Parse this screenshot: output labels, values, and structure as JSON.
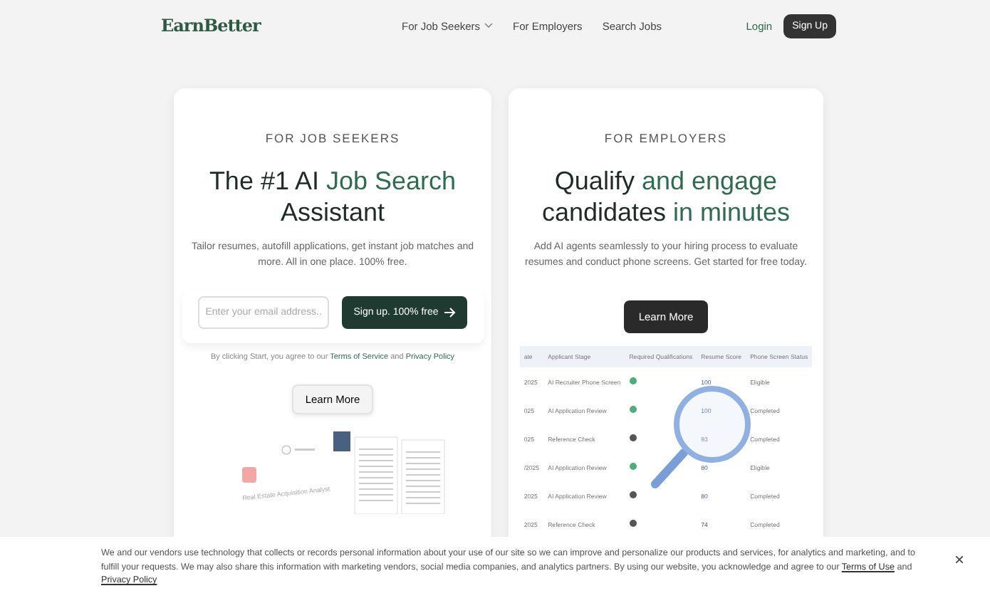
{
  "nav": {
    "logo": "EarnBetter",
    "links": [
      {
        "label": "For Job Seekers",
        "dropdown": true
      },
      {
        "label": "For Employers",
        "dropdown": false
      },
      {
        "label": "Search Jobs",
        "dropdown": false
      }
    ],
    "login": "Login",
    "signup": "Sign Up"
  },
  "seekers": {
    "eyebrow": "FOR JOB SEEKERS",
    "title": [
      {
        "text": "The #1 AI ",
        "accent": false
      },
      {
        "text": "Job Search",
        "accent": true
      },
      {
        "text": " Assistant",
        "accent": false
      }
    ],
    "subtitle": "Tailor resumes, autofill applications, get instant job matches and more. All in one place. 100% free.",
    "email_placeholder": "Enter your email address...",
    "cta": "Sign up. 100% free",
    "legal_prefix": "By clicking Start, you agree to our",
    "terms": "Terms of Service",
    "and": "and",
    "privacy": "Privacy Policy",
    "learn_more": "Learn More",
    "mockup_caption": "Real Estate Acquisition Analyst"
  },
  "employers": {
    "eyebrow": "FOR EMPLOYERS",
    "title": [
      {
        "text": "Qualify ",
        "accent": false
      },
      {
        "text": "and engage",
        "accent": true
      },
      {
        "text": " candidates ",
        "accent": false
      },
      {
        "text": "in minutes",
        "accent": true
      }
    ],
    "subtitle": "Add AI agents seamlessly to your hiring process to evaluate resumes and conduct phone screens. Get started for free today.",
    "learn_more": "Learn More",
    "table": {
      "columns": [
        "ate",
        "Applicant Stage",
        "Required Qualifications",
        "Resume Score",
        "Phone Screen Status"
      ],
      "rows": [
        {
          "date": "2025",
          "stage": "AI Recruiter Phone Screen",
          "met": true,
          "score": "100",
          "status": "Eligible"
        },
        {
          "date": "025",
          "stage": "AI Application Review",
          "met": true,
          "score": "100",
          "status": "Completed"
        },
        {
          "date": "025",
          "stage": "Reference Check",
          "met": false,
          "score": "93",
          "status": "Completed"
        },
        {
          "date": "/2025",
          "stage": "AI Application Review",
          "met": true,
          "score": "80",
          "status": "Eligible"
        },
        {
          "date": "2025",
          "stage": "AI Application Review",
          "met": false,
          "score": "80",
          "status": "Completed"
        },
        {
          "date": "2025",
          "stage": "Reference Check",
          "met": false,
          "score": "74",
          "status": "Completed"
        }
      ]
    }
  },
  "cookie": {
    "text": "We and our vendors use technology that collects or records personal information about your use of our site so we can improve and personalize our products and services, for analytics and marketing, and to fulfill your requests. We may also share this information with marketing vendors, social media companies, and analytics partners. By using our website, you acknowledge and agree to our",
    "terms": "Terms of Use",
    "and": "and",
    "privacy": "Privacy Policy",
    "close": "×"
  }
}
